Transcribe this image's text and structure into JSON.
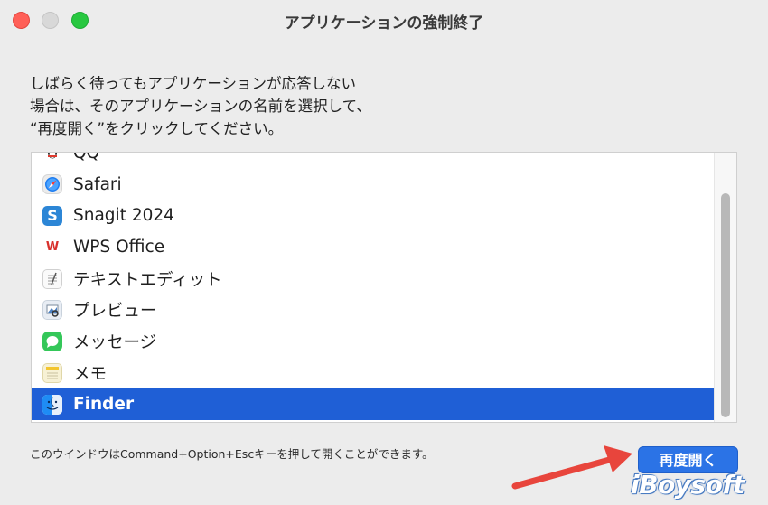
{
  "window": {
    "title": "アプリケーションの強制終了"
  },
  "instructions": [
    "しばらく待ってもアプリケーションが応答しない",
    "場合は、そのアプリケーションの名前を選択して、",
    "“再度開く”をクリックしてください。"
  ],
  "apps": [
    {
      "label": "QQ",
      "icon": "qq-icon"
    },
    {
      "label": "Safari",
      "icon": "safari-icon"
    },
    {
      "label": "Snagit 2024",
      "icon": "snagit-icon"
    },
    {
      "label": "WPS Office",
      "icon": "wps-office-icon"
    },
    {
      "label": "テキストエディット",
      "icon": "textedit-icon"
    },
    {
      "label": "プレビュー",
      "icon": "preview-icon"
    },
    {
      "label": "メッセージ",
      "icon": "messages-icon"
    },
    {
      "label": "メモ",
      "icon": "notes-icon"
    },
    {
      "label": "Finder",
      "icon": "finder-icon",
      "selected": true
    }
  ],
  "icon_glyphs": {
    "snagit": "S",
    "wps": "W"
  },
  "hint": "このウインドウはCommand+Option+Escキーを押して開くことができます。",
  "relaunch_button": "再度開く",
  "watermark": "iBoysoft",
  "colors": {
    "selection": "#1f5fd6",
    "button": "#2b73e6",
    "arrow": "#e8453c",
    "close": "#ff5f57",
    "maximize": "#28c840"
  }
}
